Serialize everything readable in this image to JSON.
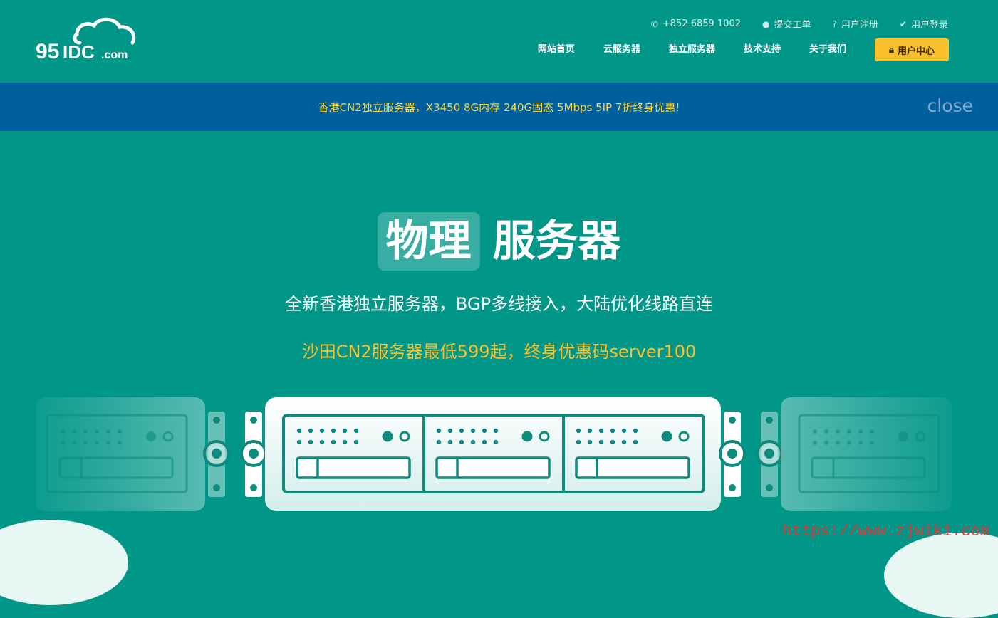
{
  "header": {
    "logo": {
      "text": "95IDC.com",
      "icon": "cloud-logo-icon"
    },
    "topbar": [
      {
        "icon": "phone-icon",
        "label": "+852 6859 1002"
      },
      {
        "icon": "chat-icon",
        "label": "提交工单"
      },
      {
        "icon": "help-icon",
        "label": "用户注册"
      },
      {
        "icon": "check-icon",
        "label": "用户登录"
      }
    ],
    "nav": [
      {
        "label": "网站首页"
      },
      {
        "label": "云服务器"
      },
      {
        "label": "独立服务器"
      },
      {
        "label": "技术支持"
      },
      {
        "label": "关于我们"
      }
    ],
    "user_center": {
      "icon": "lock-icon",
      "label": "用户中心"
    }
  },
  "banner": {
    "text": "香港CN2独立服务器，X3450 8G内存 240G固态 5Mbps 5IP 7折终身优惠!",
    "close_label": "close"
  },
  "hero": {
    "title_highlight": "物理",
    "title_rest": "服务器",
    "subtitle": "全新香港独立服务器，BGP多线接入，大陆优化线路直连",
    "promo": "沙田CN2服务器最低599起，终身优惠码server100"
  },
  "watermark": "https://www.zjwiki.com",
  "colors": {
    "primary": "#009688",
    "banner": "#005f9e",
    "accent": "#fbc02d"
  }
}
